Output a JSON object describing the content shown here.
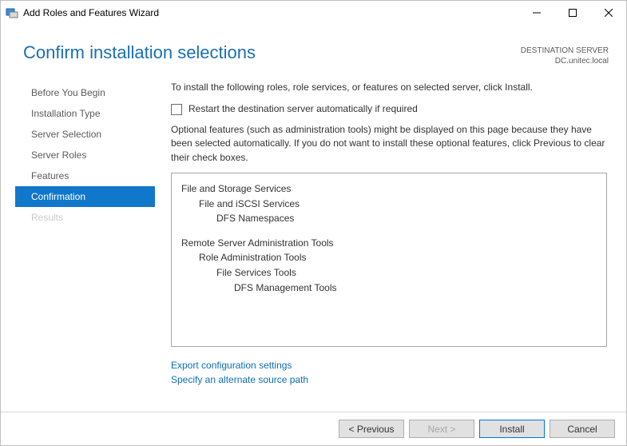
{
  "window": {
    "title": "Add Roles and Features Wizard"
  },
  "header": {
    "page_title": "Confirm installation selections",
    "dest_label": "DESTINATION SERVER",
    "dest_server": "DC.unitec.local"
  },
  "sidebar": {
    "items": [
      "Before You Begin",
      "Installation Type",
      "Server Selection",
      "Server Roles",
      "Features",
      "Confirmation",
      "Results"
    ],
    "active_index": 5,
    "disabled_index": 6
  },
  "main": {
    "instruction": "To install the following roles, role services, or features on selected server, click Install.",
    "restart_label": "Restart the destination server automatically if required",
    "restart_checked": false,
    "optional_note": "Optional features (such as administration tools) might be displayed on this page because they have been selected automatically. If you do not want to install these optional features, click Previous to clear their check boxes.",
    "selections": [
      {
        "text": "File and Storage Services",
        "level": 0
      },
      {
        "text": "File and iSCSI Services",
        "level": 1
      },
      {
        "text": "DFS Namespaces",
        "level": 2
      },
      {
        "gap": true
      },
      {
        "text": "Remote Server Administration Tools",
        "level": 0
      },
      {
        "text": "Role Administration Tools",
        "level": 1
      },
      {
        "text": "File Services Tools",
        "level": 2
      },
      {
        "text": "DFS Management Tools",
        "level": 3
      }
    ],
    "link_export": "Export configuration settings",
    "link_altsource": "Specify an alternate source path"
  },
  "footer": {
    "previous": "< Previous",
    "next": "Next >",
    "install": "Install",
    "cancel": "Cancel"
  }
}
